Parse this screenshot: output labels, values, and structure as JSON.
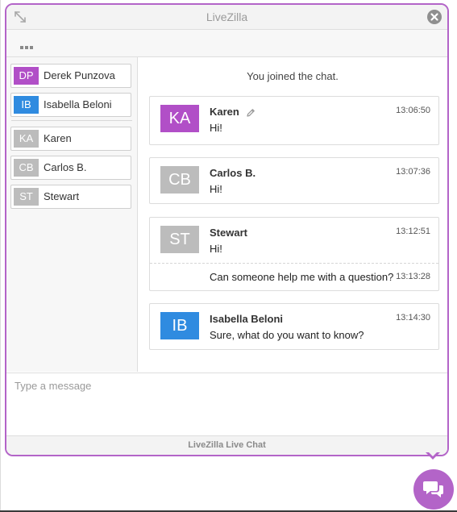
{
  "window": {
    "title": "LiveZilla",
    "footer": "LiveZilla Live Chat"
  },
  "colors": {
    "accent": "#b364c8",
    "avatar_purple": "#b14fc7",
    "avatar_blue": "#2f8be0",
    "avatar_gray": "#bcbcbc"
  },
  "icons": {
    "expand": "expand-icon",
    "close": "close-icon",
    "more": "more-icon",
    "edit": "pencil-icon",
    "launcher": "chat-bubbles-icon"
  },
  "participants": {
    "operators": [
      {
        "initials": "DP",
        "name": "Derek Punzova",
        "color": "#b14fc7"
      },
      {
        "initials": "IB",
        "name": "Isabella Beloni",
        "color": "#2f8be0"
      }
    ],
    "visitors": [
      {
        "initials": "KA",
        "name": "Karen",
        "color": "#bcbcbc"
      },
      {
        "initials": "CB",
        "name": "Carlos B.",
        "color": "#bcbcbc"
      },
      {
        "initials": "ST",
        "name": "Stewart",
        "color": "#bcbcbc"
      }
    ]
  },
  "chat": {
    "system_message": "You joined the chat.",
    "messages": [
      {
        "initials": "KA",
        "author": "Karen",
        "time": "13:06:50",
        "text": "Hi!",
        "color": "#b14fc7"
      },
      {
        "initials": "CB",
        "author": "Carlos B.",
        "time": "13:07:36",
        "text": "Hi!",
        "color": "#bcbcbc"
      },
      {
        "initials": "ST",
        "author": "Stewart",
        "time": "13:12:51",
        "text": "Hi!",
        "color": "#bcbcbc",
        "followup_text": "Can someone help me with a question?",
        "followup_time": "13:13:28"
      },
      {
        "initials": "IB",
        "author": "Isabella Beloni",
        "time": "13:14:30",
        "text": "Sure, what do you want to know?",
        "color": "#2f8be0"
      }
    ]
  },
  "input": {
    "placeholder": "Type a message",
    "value": ""
  }
}
